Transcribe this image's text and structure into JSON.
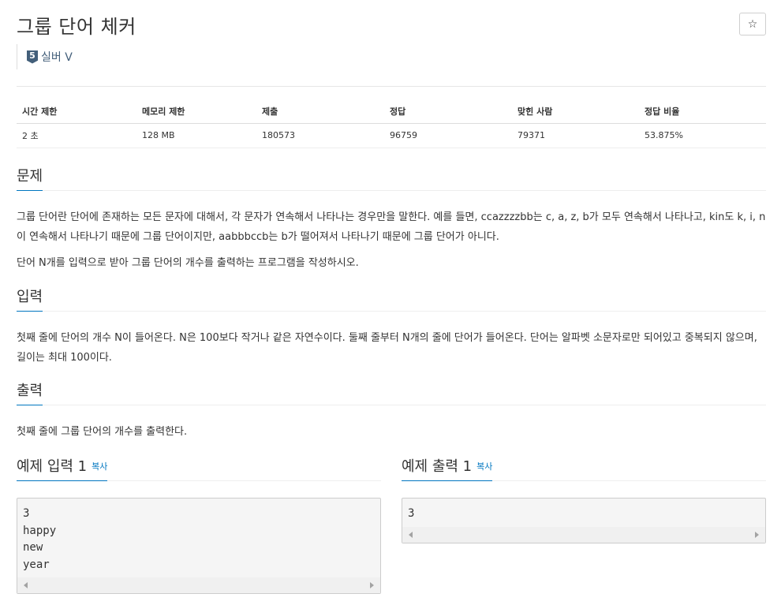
{
  "problem": {
    "title": "그룹 단어 체커",
    "star_icon": "☆",
    "tier": {
      "number": "5",
      "label": "실버 V"
    }
  },
  "info_table": {
    "headers": [
      "시간 제한",
      "메모리 제한",
      "제출",
      "정답",
      "맞힌 사람",
      "정답 비율"
    ],
    "values": [
      "2 초",
      "128 MB",
      "180573",
      "96759",
      "79371",
      "53.875%"
    ]
  },
  "sections": {
    "problem": {
      "heading": "문제",
      "paragraphs": [
        "그룹 단어란 단어에 존재하는 모든 문자에 대해서, 각 문자가 연속해서 나타나는 경우만을 말한다. 예를 들면, ccazzzzbb는 c, a, z, b가 모두 연속해서 나타나고, kin도 k, i, n이 연속해서 나타나기 때문에 그룹 단어이지만, aabbbccb는 b가 떨어져서 나타나기 때문에 그룹 단어가 아니다.",
        "단어 N개를 입력으로 받아 그룹 단어의 개수를 출력하는 프로그램을 작성하시오."
      ]
    },
    "input": {
      "heading": "입력",
      "paragraphs": [
        "첫째 줄에 단어의 개수 N이 들어온다. N은 100보다 작거나 같은 자연수이다. 둘째 줄부터 N개의 줄에 단어가 들어온다. 단어는 알파벳 소문자로만 되어있고 중복되지 않으며, 길이는 최대 100이다."
      ]
    },
    "output": {
      "heading": "출력",
      "paragraphs": [
        "첫째 줄에 그룹 단어의 개수를 출력한다."
      ]
    }
  },
  "samples": {
    "copy_label": "복사",
    "input": {
      "heading": "예제 입력 1",
      "content": "3\nhappy\nnew\nyear"
    },
    "output": {
      "heading": "예제 출력 1",
      "content": "3"
    }
  }
}
